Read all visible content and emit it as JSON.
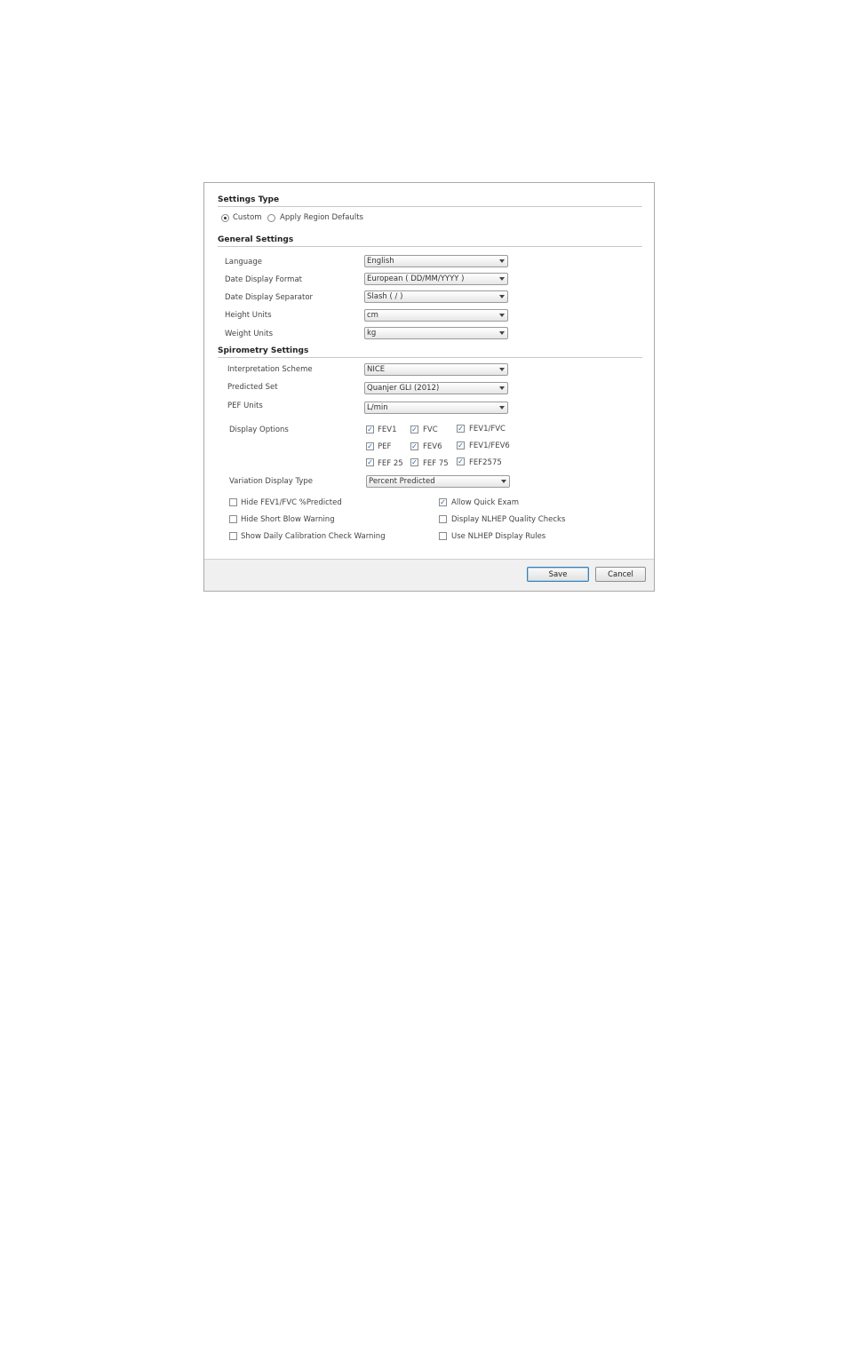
{
  "settings_type": {
    "title": "Settings Type",
    "options": [
      "Custom",
      "Apply Region Defaults"
    ],
    "selected": "Custom"
  },
  "general": {
    "title": "General Settings",
    "fields": [
      {
        "label": "Language",
        "value": "English"
      },
      {
        "label": "Date Display Format",
        "value": "European ( DD/MM/YYYY )"
      },
      {
        "label": "Date Display Separator",
        "value": "Slash ( / )"
      },
      {
        "label": "Height Units",
        "value": "cm"
      },
      {
        "label": "Weight Units",
        "value": "kg"
      }
    ]
  },
  "spirometry": {
    "title": "Spirometry Settings",
    "fields": [
      {
        "label": "Interpretation Scheme",
        "value": "NICE"
      },
      {
        "label": "Predicted Set",
        "value": "Quanjer GLI (2012)"
      },
      {
        "label": "PEF Units",
        "value": "L/min"
      }
    ],
    "display_options_label": "Display Options",
    "display_options": [
      {
        "label": "FEV1",
        "checked": true
      },
      {
        "label": "FVC",
        "checked": true
      },
      {
        "label": "FEV1/FVC",
        "checked": true
      },
      {
        "label": "PEF",
        "checked": true
      },
      {
        "label": "FEV6",
        "checked": true
      },
      {
        "label": "FEV1/FEV6",
        "checked": true
      },
      {
        "label": "FEF 25",
        "checked": true
      },
      {
        "label": "FEF 75",
        "checked": true
      },
      {
        "label": "FEF2575",
        "checked": true
      }
    ],
    "variation_label": "Variation Display Type",
    "variation_value": "Percent Predicted",
    "checks_left": [
      {
        "label": "Hide FEV1/FVC %Predicted",
        "checked": false
      },
      {
        "label": "Hide Short Blow Warning",
        "checked": false
      },
      {
        "label": "Show Daily Calibration Check Warning",
        "checked": false
      }
    ],
    "checks_right": [
      {
        "label": "Allow Quick Exam",
        "checked": true
      },
      {
        "label": "Display NLHEP Quality Checks",
        "checked": false
      },
      {
        "label": "Use NLHEP Display Rules",
        "checked": false
      }
    ]
  },
  "footer": {
    "save_label": "Save",
    "cancel_label": "Cancel"
  }
}
